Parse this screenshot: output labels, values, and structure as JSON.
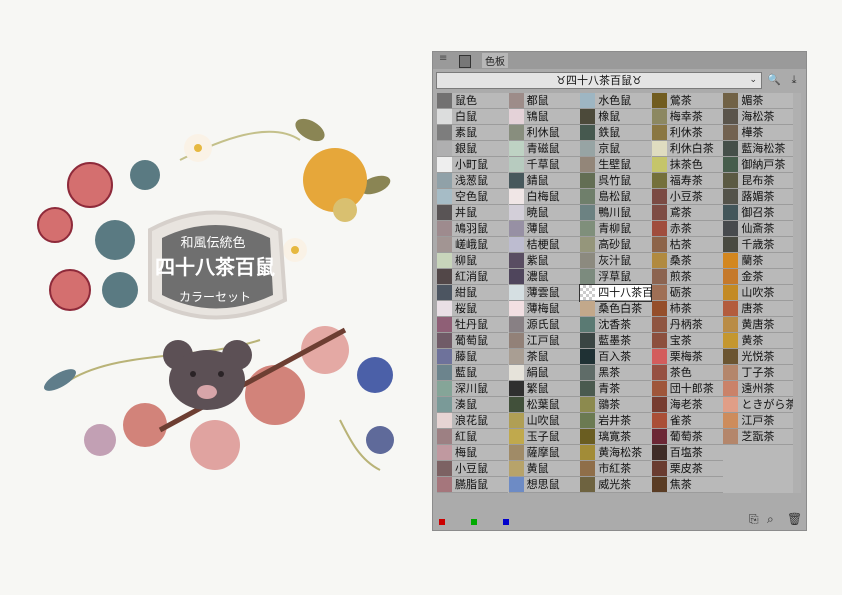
{
  "artwork": {
    "top_text": "和風伝統色",
    "main_text": "四十八茶百鼠",
    "bottom_text": "カラーセット"
  },
  "panel": {
    "menu_icon": "≡",
    "tab_label": "色板",
    "set_name": "♉四十八茶百鼠♉",
    "select_chevron": "⌄",
    "tools": [
      "🔍",
      "⤓"
    ],
    "footer_buttons": [
      "⎘",
      "⌕",
      "🗑"
    ],
    "rgb_colors": [
      "#cc0000",
      "#00aa00",
      "#0000cc"
    ]
  },
  "columns": [
    [
      {
        "name": "鼠色",
        "color": "#727171"
      },
      {
        "name": "白鼠",
        "color": "#dcdddd"
      },
      {
        "name": "素鼠",
        "color": "#7d7d7d"
      },
      {
        "name": "銀鼠",
        "color": "#afafb0"
      },
      {
        "name": "小町鼠",
        "color": "#eeeeee"
      },
      {
        "name": "浅葱鼠",
        "color": "#90a1a8"
      },
      {
        "name": "空色鼠",
        "color": "#a6bcc6"
      },
      {
        "name": "丼鼠",
        "color": "#595455"
      },
      {
        "name": "鳩羽鼠",
        "color": "#9e8b8e"
      },
      {
        "name": "嵯峨鼠",
        "color": "#a29593"
      },
      {
        "name": "柳鼠",
        "color": "#c8d5bb"
      },
      {
        "name": "紅消鼠",
        "color": "#524748"
      },
      {
        "name": "紺鼠",
        "color": "#4c5561"
      },
      {
        "name": "桜鼠",
        "color": "#e9dfe5"
      },
      {
        "name": "牡丹鼠",
        "color": "#8f5f76"
      },
      {
        "name": "葡萄鼠",
        "color": "#705b67"
      },
      {
        "name": "藤鼠",
        "color": "#6e729b"
      },
      {
        "name": "藍鼠",
        "color": "#6c848d"
      },
      {
        "name": "深川鼠",
        "color": "#85a598"
      },
      {
        "name": "湊鼠",
        "color": "#7a9a98"
      },
      {
        "name": "浪花鼠",
        "color": "#e6d4d3"
      },
      {
        "name": "紅鼠",
        "color": "#9d8083"
      },
      {
        "name": "梅鼠",
        "color": "#c099a0"
      },
      {
        "name": "小豆鼠",
        "color": "#7c6263"
      },
      {
        "name": "臙脂鼠",
        "color": "#a5767c"
      }
    ],
    [
      {
        "name": "都鼠",
        "color": "#9d8c89"
      },
      {
        "name": "鴇鼠",
        "color": "#e4d2d8"
      },
      {
        "name": "利休鼠",
        "color": "#888e7e"
      },
      {
        "name": "青磁鼠",
        "color": "#bed2c3"
      },
      {
        "name": "千草鼠",
        "color": "#b7cbbf"
      },
      {
        "name": "錆鼠",
        "color": "#47585c"
      },
      {
        "name": "白梅鼠",
        "color": "#f0e6e6"
      },
      {
        "name": "暁鼠",
        "color": "#d3cfd9"
      },
      {
        "name": "薄鼠",
        "color": "#9790a4"
      },
      {
        "name": "桔梗鼠",
        "color": "#bdbcd0"
      },
      {
        "name": "紫鼠",
        "color": "#594d62"
      },
      {
        "name": "濃鼠",
        "color": "#4f455c"
      },
      {
        "name": "薄雲鼠",
        "color": "#d5dfe2"
      },
      {
        "name": "薄梅鼠",
        "color": "#f2dfe2"
      },
      {
        "name": "源氏鼠",
        "color": "#888084"
      },
      {
        "name": "江戸鼠",
        "color": "#928178"
      },
      {
        "name": "茶鼠",
        "color": "#a99e93"
      },
      {
        "name": "絹鼠",
        "color": "#e6e3da"
      },
      {
        "name": "繁鼠",
        "color": "#2f2f2f"
      },
      {
        "name": "松葉鼠",
        "color": "#41503a"
      },
      {
        "name": "山吹鼠",
        "color": "#b09f55"
      },
      {
        "name": "玉子鼠",
        "color": "#c0a94d"
      },
      {
        "name": "薩摩鼠",
        "color": "#a08b67"
      },
      {
        "name": "黄鼠",
        "color": "#b7a36a"
      },
      {
        "name": "想思鼠",
        "color": "#6d8bc5"
      }
    ],
    [
      {
        "name": "水色鼠",
        "color": "#9eb6c3"
      },
      {
        "name": "橡鼠",
        "color": "#4c4a3a"
      },
      {
        "name": "鉄鼠",
        "color": "#46594f"
      },
      {
        "name": "京鼠",
        "color": "#97a4a4"
      },
      {
        "name": "生壁鼠",
        "color": "#938679"
      },
      {
        "name": "呉竹鼠",
        "color": "#636e54"
      },
      {
        "name": "島松鼠",
        "color": "#6f7f6b"
      },
      {
        "name": "鴨川鼠",
        "color": "#6c8282"
      },
      {
        "name": "青柳鼠",
        "color": "#7f8f7b"
      },
      {
        "name": "高砂鼠",
        "color": "#95967b"
      },
      {
        "name": "灰汁鼠",
        "color": "#8c8a7f"
      },
      {
        "name": "浮草鼠",
        "color": "#7c8b7e"
      },
      {
        "name": "四十八茶百鼠",
        "color": "checker",
        "selected": true
      },
      {
        "name": "桑色白茶",
        "color": "#c2a88b"
      },
      {
        "name": "沈香茶",
        "color": "#5a7a73"
      },
      {
        "name": "藍墨茶",
        "color": "#3a4543"
      },
      {
        "name": "百入茶",
        "color": "#1f3134"
      },
      {
        "name": "黑茶",
        "color": "#5f6c68"
      },
      {
        "name": "青茶",
        "color": "#4a5a4f"
      },
      {
        "name": "鶸茶",
        "color": "#8c8a4e"
      },
      {
        "name": "岩井茶",
        "color": "#6b7a52"
      },
      {
        "name": "璃寛茶",
        "color": "#6a5d21"
      },
      {
        "name": "黄海松茶",
        "color": "#a28c37"
      },
      {
        "name": "市紅茶",
        "color": "#8f6e49"
      },
      {
        "name": "威光茶",
        "color": "#6e6340"
      }
    ],
    [
      {
        "name": "鶯茶",
        "color": "#715c1f"
      },
      {
        "name": "梅幸茶",
        "color": "#8c8861"
      },
      {
        "name": "利休茶",
        "color": "#8a7742"
      },
      {
        "name": "利休白茶",
        "color": "#dfdcc0"
      },
      {
        "name": "抹茶色",
        "color": "#c5c56a"
      },
      {
        "name": "福寿茶",
        "color": "#74703b"
      },
      {
        "name": "小豆茶",
        "color": "#7b4a43"
      },
      {
        "name": "鳶茶",
        "color": "#7e4c44"
      },
      {
        "name": "赤茶",
        "color": "#a04d3d"
      },
      {
        "name": "枯茶",
        "color": "#8d6449"
      },
      {
        "name": "桑茶",
        "color": "#b18a3f"
      },
      {
        "name": "煎茶",
        "color": "#8c6450"
      },
      {
        "name": "砺茶",
        "color": "#9f6f55"
      },
      {
        "name": "柿茶",
        "color": "#954e2a"
      },
      {
        "name": "丹柄茶",
        "color": "#8f5541"
      },
      {
        "name": "宝茶",
        "color": "#8c4f3d"
      },
      {
        "name": "栗梅茶",
        "color": "#d35d5d"
      },
      {
        "name": "茶色",
        "color": "#965042"
      },
      {
        "name": "団十郎茶",
        "color": "#9f563a"
      },
      {
        "name": "海老茶",
        "color": "#773c30"
      },
      {
        "name": "雀茶",
        "color": "#aa4f37"
      },
      {
        "name": "葡萄茶",
        "color": "#6c2735"
      },
      {
        "name": "百塩茶",
        "color": "#3f2c27"
      },
      {
        "name": "栗皮茶",
        "color": "#6a3c30"
      },
      {
        "name": "焦茶",
        "color": "#5a3c24"
      }
    ],
    [
      {
        "name": "媚茶",
        "color": "#716246"
      },
      {
        "name": "海松茶",
        "color": "#5a544b"
      },
      {
        "name": "樺茶",
        "color": "#726250"
      },
      {
        "name": "藍海松茶",
        "color": "#454f49"
      },
      {
        "name": "御納戸茶",
        "color": "#465d4c"
      },
      {
        "name": "昆布茶",
        "color": "#5b5a43"
      },
      {
        "name": "蕗媚茶",
        "color": "#54534a"
      },
      {
        "name": "御召茶",
        "color": "#43565a"
      },
      {
        "name": "仙斎茶",
        "color": "#474a4d"
      },
      {
        "name": "千歳茶",
        "color": "#494a41"
      },
      {
        "name": "蘭茶",
        "color": "#d3871f"
      },
      {
        "name": "金茶",
        "color": "#c5792a"
      },
      {
        "name": "山吹茶",
        "color": "#c38a24"
      },
      {
        "name": "唐茶",
        "color": "#b35c3d"
      },
      {
        "name": "黄唐茶",
        "color": "#b98c46"
      },
      {
        "name": "黄茶",
        "color": "#c4972f"
      },
      {
        "name": "光悦茶",
        "color": "#6b5531"
      },
      {
        "name": "丁子茶",
        "color": "#b4866b"
      },
      {
        "name": "遠州茶",
        "color": "#ca8269"
      },
      {
        "name": "ときがら茶",
        "color": "#e09e87"
      },
      {
        "name": "江戸茶",
        "color": "#cd8c5c"
      },
      {
        "name": "芝翫茶",
        "color": "#b4866b"
      }
    ]
  ]
}
